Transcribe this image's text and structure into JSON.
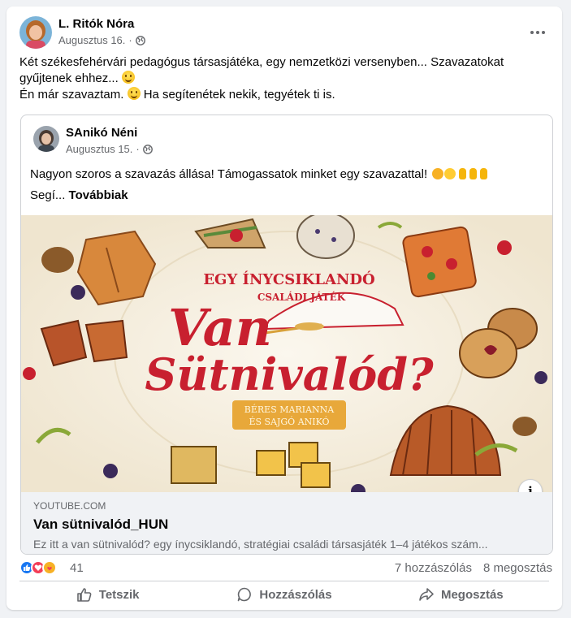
{
  "post": {
    "author": "L. Ritók Nóra",
    "date": "Augusztus 16.",
    "separator": "·",
    "text_line1": "Két székesfehérvári pedagógus társasjátéka, egy nemzetközi versenyben... Szavazatokat gyűjtenek ehhez...",
    "text_line2": "Én már szavaztam.",
    "text_line3": "Ha segítenétek nekik, tegyétek ti is."
  },
  "shared": {
    "author": "SAnikó Néni",
    "date": "Augusztus 15.",
    "separator": "·",
    "text": "Nagyon szoros a szavazás állása! Támogassatok minket egy szavazattal!",
    "more_prefix": "Segí...",
    "more_link": "Továbbiak",
    "banner": {
      "tagline1": "EGY ÍNYCSIKLANDÓ",
      "tagline2": "CSALÁDI JÁTÉK",
      "title1": "Van",
      "title2": "Sütnivalód?",
      "authors1": "BÉRES MARIANNA",
      "authors2": "ÉS SAJGÓ ANIKÓ"
    },
    "info_label": "i",
    "link": {
      "domain": "YOUTUBE.COM",
      "title": "Van sütnivalód_HUN",
      "description": "Ez itt a van sütnivalód? egy ínycsiklandó, stratégiai családi társasjáték 1–4 játékos szám..."
    }
  },
  "stats": {
    "reaction_count": "41",
    "comments": "7 hozzászólás",
    "shares": "8 megosztás"
  },
  "actions": {
    "like": "Tetszik",
    "comment": "Hozzászólás",
    "share": "Megosztás"
  },
  "colors": {
    "like_blue": "#1877f2",
    "love_red": "#f33e58",
    "care_yellow": "#f7b125",
    "title_red": "#c8202f",
    "muted": "#65676b"
  }
}
